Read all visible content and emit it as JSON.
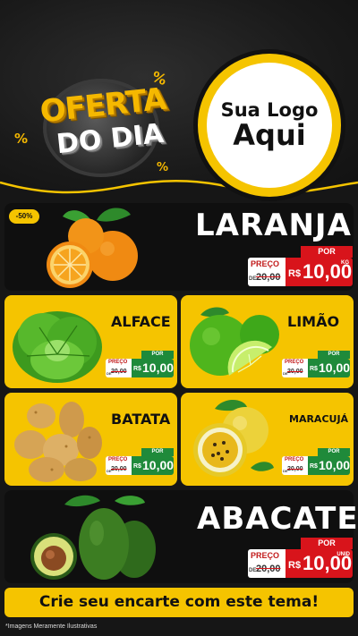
{
  "header": {
    "badge_line1": "OFERTA",
    "badge_line2": "DO DIA",
    "percent_symbol": "%",
    "logo_line1": "Sua Logo",
    "logo_line2": "Aqui"
  },
  "colors": {
    "brand_yellow": "#f5c400",
    "price_red": "#d8141b",
    "price_green": "#1f8a3a",
    "background": "#161616"
  },
  "products": {
    "laranja": {
      "name": "LARANJA",
      "discount": "-50%",
      "por": "POR",
      "preco_label": "PREÇO",
      "de": "DE",
      "old_price": "20,00",
      "currency": "R$",
      "price": "10,00",
      "unit": "KG"
    },
    "alface": {
      "name": "ALFACE",
      "por": "POR",
      "preco_label": "PREÇO",
      "de": "DE",
      "old_price": "20,00",
      "currency": "R$",
      "price": "10,00"
    },
    "limao": {
      "name": "LIMÃO",
      "por": "POR",
      "preco_label": "PREÇO",
      "de": "DE",
      "old_price": "20,00",
      "currency": "R$",
      "price": "10,00"
    },
    "batata": {
      "name": "BATATA",
      "por": "POR",
      "preco_label": "PREÇO",
      "de": "DE",
      "old_price": "20,00",
      "currency": "R$",
      "price": "10,00"
    },
    "maracuja": {
      "name": "MARACUJÁ",
      "por": "POR",
      "preco_label": "PREÇO",
      "de": "DE",
      "old_price": "20,00",
      "currency": "R$",
      "price": "10,00"
    },
    "abacate": {
      "name": "ABACATE",
      "por": "POR",
      "preco_label": "PREÇO",
      "de": "DE",
      "old_price": "20,00",
      "currency": "R$",
      "price": "10,00",
      "unit": "UNID"
    }
  },
  "cta": "Crie seu encarte com este tema!",
  "footnote": "*Imagens Meramente Ilustrativas"
}
